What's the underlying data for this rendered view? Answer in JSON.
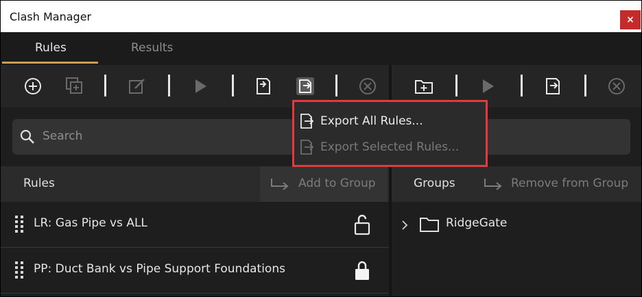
{
  "window": {
    "title": "Clash Manager",
    "close_glyph": "×"
  },
  "tabs": [
    {
      "label": "Rules",
      "active": true
    },
    {
      "label": "Results",
      "active": false
    }
  ],
  "toolbar_left": {
    "icons": [
      "add-rule-icon",
      "duplicate-icon",
      "edit-icon",
      "run-icon",
      "import-icon",
      "export-icon",
      "delete-icon"
    ]
  },
  "toolbar_right": {
    "icons": [
      "new-group-icon",
      "run-icon",
      "export-icon",
      "delete-icon"
    ]
  },
  "search": {
    "placeholder": "Search",
    "icon": "search-icon"
  },
  "rules_panel": {
    "header": "Rules",
    "add_to_group_label": "Add to Group",
    "rows": [
      {
        "label": "LR: Gas Pipe vs ALL",
        "lock": "unlocked-lock-icon"
      },
      {
        "label": "PP: Duct Bank vs Pipe Support Foundations",
        "lock": "locked-lock-icon"
      }
    ]
  },
  "groups_panel": {
    "header": "Groups",
    "remove_from_group_label": "Remove from Group",
    "items": [
      {
        "label": "RidgeGate",
        "icon": "folder-icon"
      }
    ]
  },
  "export_menu": {
    "items": [
      {
        "label": "Export All Rules...",
        "enabled": true
      },
      {
        "label": "Export Selected Rules...",
        "enabled": false
      }
    ]
  },
  "colors": {
    "background": "#1e1e1e",
    "tab_accent": "#c9a14a",
    "highlight_border": "#e03c3c",
    "close_button": "#c42b2b"
  }
}
